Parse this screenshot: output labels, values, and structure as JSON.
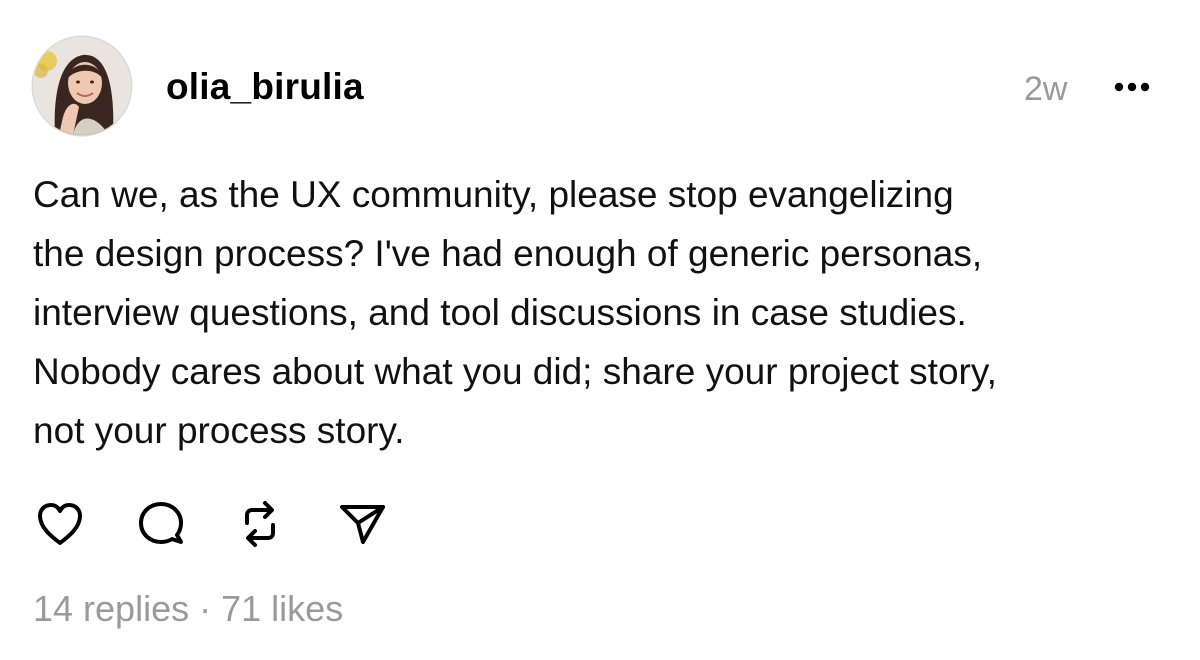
{
  "post": {
    "author": {
      "username": "olia_birulia",
      "avatar_icon": "profile-photo"
    },
    "timestamp": "2w",
    "more_icon": "ellipsis-icon",
    "text_lines": [
      "Can we, as the UX community, please stop evangelizing",
      "the design process? I've had enough of generic personas,",
      "interview questions, and tool discussions in case studies.",
      "Nobody cares about what you did; share your project story,",
      "not your process story."
    ],
    "actions": [
      {
        "name": "like",
        "icon": "heart-icon"
      },
      {
        "name": "reply",
        "icon": "comment-icon"
      },
      {
        "name": "repost",
        "icon": "repost-icon"
      },
      {
        "name": "share",
        "icon": "send-icon"
      }
    ],
    "stats": {
      "replies": "14 replies",
      "separator": "·",
      "likes": "71 likes"
    }
  },
  "colors": {
    "text": "#111111",
    "muted": "#9a9a9a",
    "background": "#ffffff"
  }
}
